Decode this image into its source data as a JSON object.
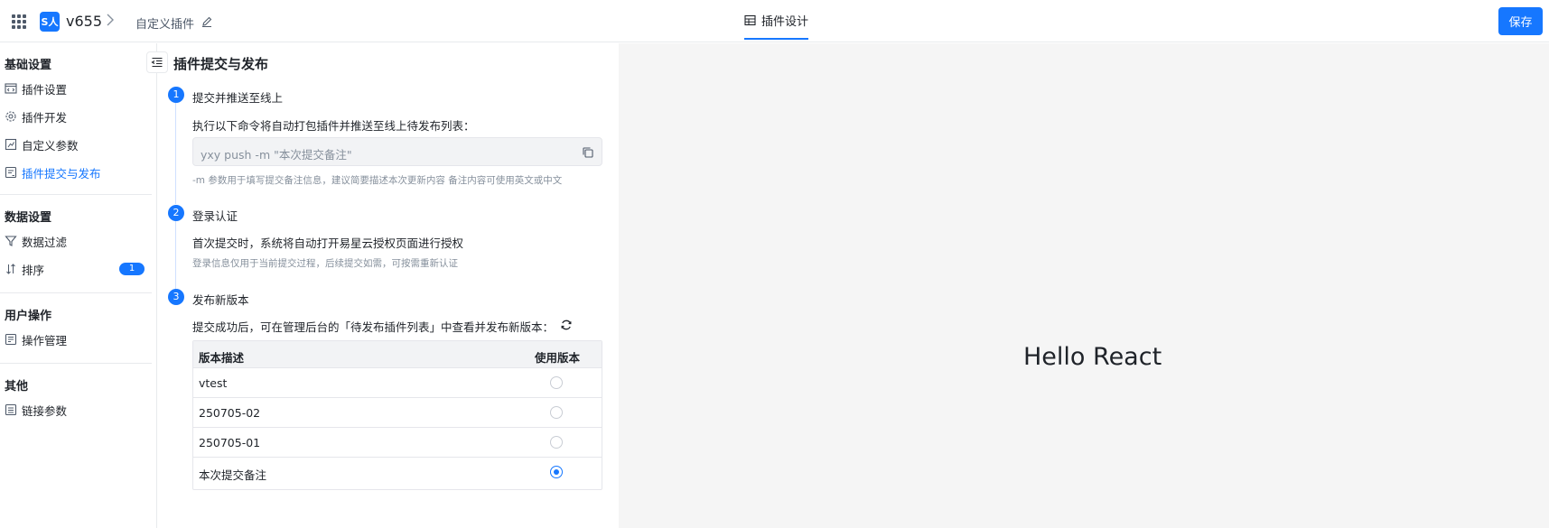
{
  "header": {
    "app_name": "v655",
    "breadcrumb_sep": ">",
    "page_name": "自定义插件",
    "center_tab": "插件设计",
    "save_label": "保存",
    "logo_text": "S人",
    "accent": "#1677ff"
  },
  "sidebar": {
    "sections": [
      {
        "title": "基础设置",
        "items": [
          {
            "label": "插件设置",
            "icon": "code-window-icon"
          },
          {
            "label": "插件开发",
            "icon": "gear-icon"
          },
          {
            "label": "自定义参数",
            "icon": "chart-icon"
          },
          {
            "label": "插件提交与发布",
            "icon": "publish-icon",
            "active": true
          }
        ]
      },
      {
        "title": "数据设置",
        "items": [
          {
            "label": "数据过滤",
            "icon": "filter-icon"
          },
          {
            "label": "排序",
            "icon": "sort-icon",
            "badge": "1"
          }
        ]
      },
      {
        "title": "用户操作",
        "items": [
          {
            "label": "操作管理",
            "icon": "operation-icon"
          }
        ]
      },
      {
        "title": "其他",
        "items": [
          {
            "label": "链接参数",
            "icon": "link-param-icon"
          }
        ]
      }
    ]
  },
  "main": {
    "title": "插件提交与发布",
    "steps": [
      {
        "num": "1",
        "title": "提交并推送至线上",
        "desc": "执行以下命令将自动打包插件并推送至线上待发布列表：",
        "command": "yxy push -m \"本次提交备注\"",
        "hint": "-m 参数用于填写提交备注信息，建议简要描述本次更新内容 备注内容可使用英文或中文"
      },
      {
        "num": "2",
        "title": "登录认证",
        "desc": "首次提交时，系统将自动打开易星云授权页面进行授权",
        "hint": "登录信息仅用于当前提交过程，后续提交如需，可按需重新认证"
      },
      {
        "num": "3",
        "title": "发布新版本",
        "desc": "提交成功后，可在管理后台的「待发布插件列表」中查看并发布新版本："
      }
    ],
    "table": {
      "headers": [
        "版本描述",
        "使用版本"
      ],
      "rows": [
        {
          "desc": "vtest",
          "selected": false
        },
        {
          "desc": "250705-02",
          "selected": false
        },
        {
          "desc": "250705-01",
          "selected": false
        },
        {
          "desc": "本次提交备注",
          "selected": true
        }
      ]
    }
  },
  "preview": {
    "text": "Hello React"
  }
}
